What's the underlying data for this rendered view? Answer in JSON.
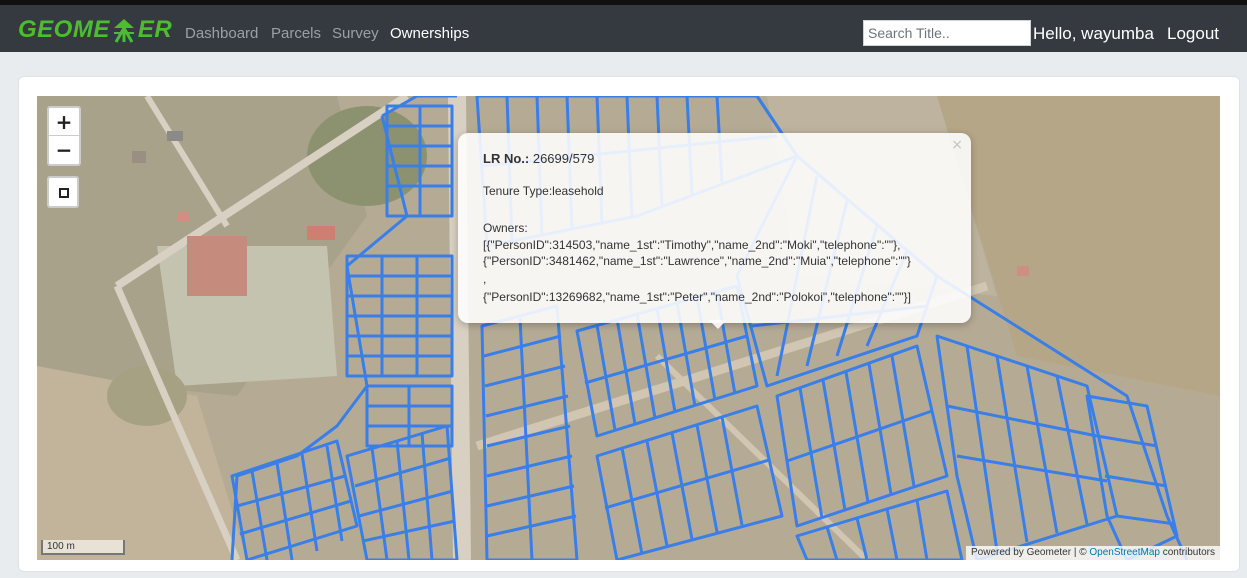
{
  "brand": {
    "left": "GEOME",
    "right": "ER",
    "icon": "green-surveyor-tripod-icon"
  },
  "nav": {
    "items": [
      {
        "label": "Dashboard",
        "active": false
      },
      {
        "label": "Parcels",
        "active": false
      },
      {
        "label": "Survey",
        "active": false
      },
      {
        "label": "Ownerships",
        "active": true
      }
    ]
  },
  "search": {
    "placeholder": "Search Title.."
  },
  "user": {
    "greeting": "Hello, wayumba",
    "logout": "Logout"
  },
  "map": {
    "controls": {
      "zoom_in": "+",
      "zoom_out": "−",
      "fullscreen_icon": "square-frame-icon"
    },
    "popup": {
      "close": "×",
      "lr_label": "LR No.:",
      "lr_value": "26699/579",
      "tenure": "Tenure Type:leasehold",
      "owners_label": "Owners:",
      "owners_line1": "[{\"PersonID\":314503,\"name_1st\":\"Timothy\",\"name_2nd\":\"Moki\",\"telephone\":\"\"},",
      "owners_line2": "{\"PersonID\":3481462,\"name_1st\":\"Lawrence\",\"name_2nd\":\"Muia\",\"telephone\":\"\"}",
      "owners_sep": ",",
      "owners_line3": "{\"PersonID\":13269682,\"name_1st\":\"Peter\",\"name_2nd\":\"Polokoi\",\"telephone\":\"\"}]"
    },
    "scale": "100 m",
    "attribution": {
      "prefix": "Powered by Geometer | © ",
      "link": "OpenStreetMap",
      "suffix": " contributors"
    },
    "colors": {
      "parcel": "#3a7ee8",
      "ground": "#b7ad97",
      "road": "#d8d0c2"
    }
  }
}
